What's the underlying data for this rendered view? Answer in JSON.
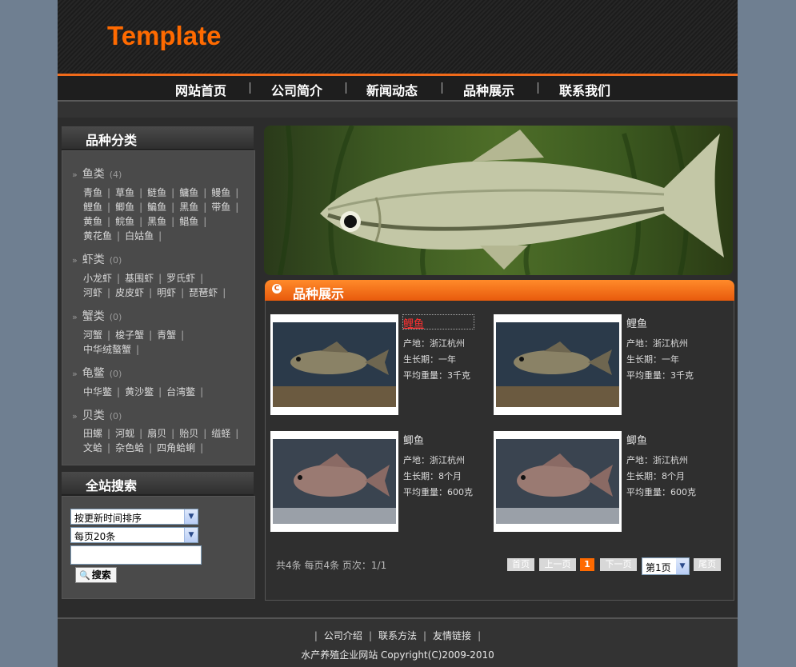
{
  "header": {
    "logo": "Template"
  },
  "nav": {
    "items": [
      {
        "label": "网站首页"
      },
      {
        "label": "公司简介"
      },
      {
        "label": "新闻动态"
      },
      {
        "label": "品种展示"
      },
      {
        "label": "联系我们"
      }
    ]
  },
  "categories": {
    "title": "品种分类",
    "groups": [
      {
        "name": "鱼类",
        "count": "(4)",
        "rows": [
          [
            "青鱼",
            "草鱼",
            "鲢鱼",
            "鳙鱼",
            "鳗鱼"
          ],
          [
            "鲤鱼",
            "鲫鱼",
            "鳊鱼",
            "黑鱼",
            "带鱼"
          ],
          [
            "黄鱼",
            "鲩鱼",
            "黑鱼",
            "鲳鱼"
          ],
          [
            "黄花鱼",
            "白姑鱼"
          ]
        ]
      },
      {
        "name": "虾类",
        "count": "(0)",
        "rows": [
          [
            "小龙虾",
            "基围虾",
            "罗氏虾"
          ],
          [
            "河虾",
            "皮皮虾",
            "明虾",
            "琵琶虾"
          ]
        ]
      },
      {
        "name": "蟹类",
        "count": "(0)",
        "rows": [
          [
            "河蟹",
            "梭子蟹",
            "青蟹"
          ],
          [
            "中华绒螯蟹"
          ]
        ]
      },
      {
        "name": "龟鳖",
        "count": "(0)",
        "rows": [
          [
            "中华鳖",
            "黄沙鳖",
            "台湾鳖"
          ]
        ]
      },
      {
        "name": "贝类",
        "count": "(0)",
        "rows": [
          [
            "田螺",
            "河蚬",
            "扇贝",
            "贻贝",
            "缢蛏"
          ],
          [
            "文蛤",
            "杂色蛤",
            "四角蛤蜊"
          ]
        ]
      }
    ]
  },
  "search": {
    "title": "全站搜索",
    "sort_value": "按更新时间排序",
    "per_page_value": "每页20条",
    "input_value": "",
    "button_label": "搜索"
  },
  "products": {
    "title": "品种展示",
    "items": [
      {
        "name": "鲤鱼",
        "origin": "产地：浙江杭州",
        "growth": "生长期：一年",
        "weight": "平均重量：3千克"
      },
      {
        "name": "鲤鱼",
        "origin": "产地：浙江杭州",
        "growth": "生长期：一年",
        "weight": "平均重量：3千克"
      },
      {
        "name": "鲫鱼",
        "origin": "产地：浙江杭州",
        "growth": "生长期：8个月",
        "weight": "平均重量：600克"
      },
      {
        "name": "鲫鱼",
        "origin": "产地：浙江杭州",
        "growth": "生长期：8个月",
        "weight": "平均重量：600克"
      }
    ]
  },
  "pager": {
    "info": "共4条  每页4条  页次：1/1",
    "first": "首页",
    "prev": "上一页",
    "current": "1",
    "next": "下一页",
    "select_value": "第1页",
    "last": "尾页"
  },
  "footer": {
    "links": [
      "公司介绍",
      "联系方法",
      "友情链接"
    ],
    "copyright": "水产养殖企业网站  Copyright(C)2009-2010"
  },
  "colors": {
    "accent": "#ff6a00",
    "background": "#2c2c2c",
    "outer": "#6f7f91"
  }
}
